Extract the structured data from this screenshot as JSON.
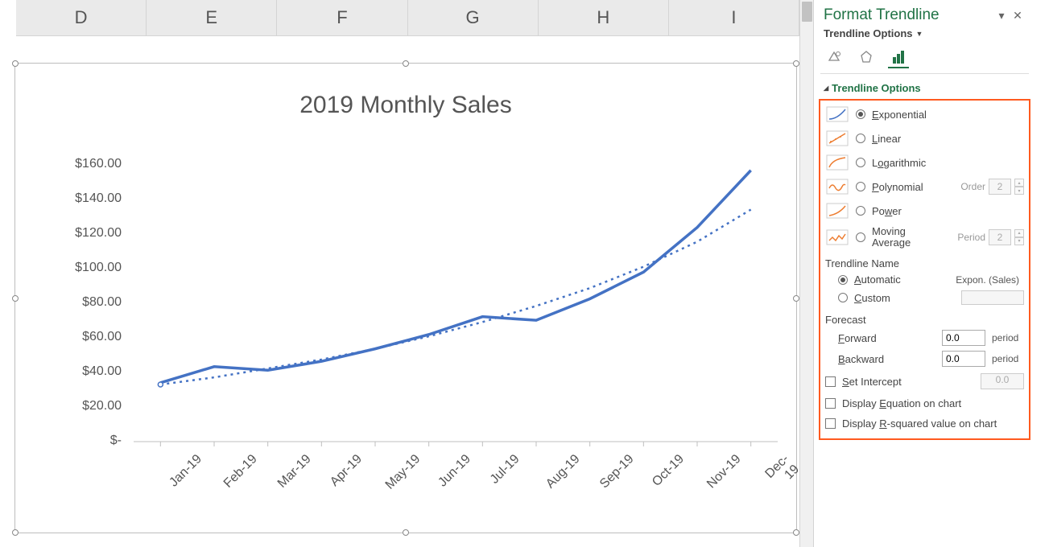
{
  "columns": [
    "D",
    "E",
    "F",
    "G",
    "H",
    "I"
  ],
  "chart_data": {
    "type": "line",
    "title": "2019 Monthly Sales",
    "categories": [
      "Jan-19",
      "Feb-19",
      "Mar-19",
      "Apr-19",
      "May-19",
      "Jun-19",
      "Jul-19",
      "Aug-19",
      "Sep-19",
      "Oct-19",
      "Nov-19",
      "Dec-19"
    ],
    "series": [
      {
        "name": "Sales",
        "values": [
          33,
          42,
          40,
          45,
          52,
          60,
          70,
          68,
          80,
          95,
          120,
          152
        ]
      }
    ],
    "trend": {
      "type": "Exponential",
      "values": [
        32,
        36,
        41,
        46,
        52,
        59,
        67,
        76,
        86,
        98,
        112,
        130
      ]
    },
    "y_ticks": [
      "$-",
      "$20.00",
      "$40.00",
      "$60.00",
      "$80.00",
      "$100.00",
      "$120.00",
      "$140.00",
      "$160.00"
    ],
    "ylim": [
      0,
      160
    ],
    "xlabel": "",
    "ylabel": ""
  },
  "pane": {
    "title": "Format Trendline",
    "sub": "Trendline Options",
    "section": "Trendline Options",
    "opts": {
      "exp": "Exponential",
      "lin": "Linear",
      "log": "Logarithmic",
      "poly": "Polynomial",
      "pow": "Power",
      "mavg_a": "Moving",
      "mavg_b": "Average",
      "order_lbl": "Order",
      "order_val": "2",
      "period_lbl": "Period",
      "period_val": "2"
    },
    "name": {
      "head": "Trendline Name",
      "auto": "Automatic",
      "custom": "Custom",
      "auto_val": "Expon. (Sales)"
    },
    "forecast": {
      "head": "Forecast",
      "fwd": "Forward",
      "bwd": "Backward",
      "fwd_val": "0.0",
      "bwd_val": "0.0",
      "unit": "period"
    },
    "intercept": {
      "label": "Set Intercept",
      "val": "0.0"
    },
    "eq": "Display Equation on chart",
    "r2": "Display R-squared value on chart"
  }
}
